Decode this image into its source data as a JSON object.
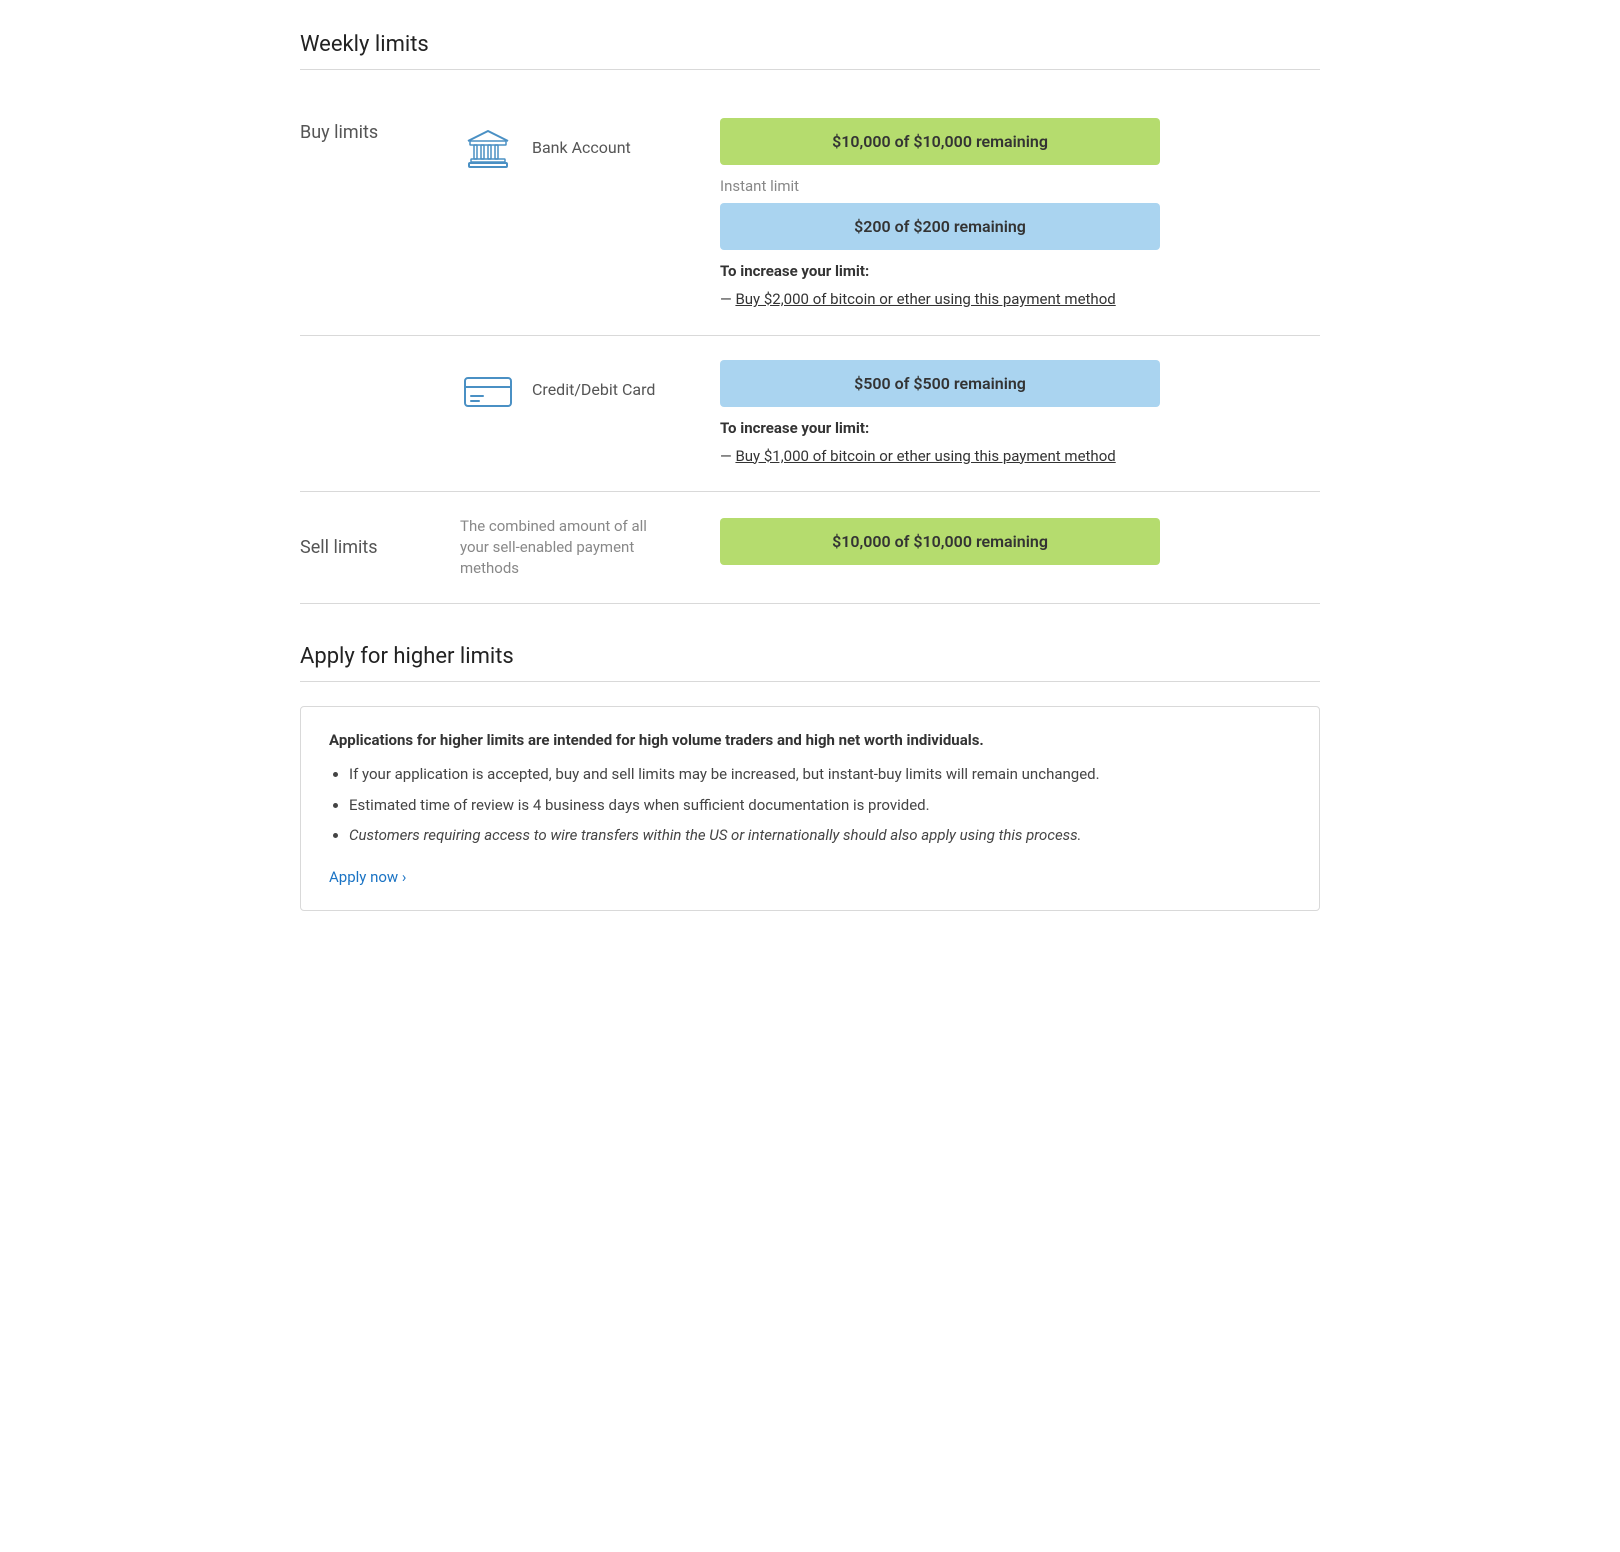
{
  "page": {
    "weekly_limits_title": "Weekly limits",
    "apply_title": "Apply for higher limits"
  },
  "buy_limits": {
    "label": "Buy limits",
    "bank_account": {
      "name": "Bank Account",
      "weekly_bar": "$10,000 of $10,000 remaining",
      "instant_label": "Instant limit",
      "instant_bar": "$200 of $200 remaining",
      "increase_title": "To increase your limit:",
      "increase_link_prefix": "— ",
      "increase_link_text": "Buy $2,000 of bitcoin or ether using this payment method"
    },
    "credit_debit": {
      "name": "Credit/Debit Card",
      "bar": "$500 of $500 remaining",
      "increase_title": "To increase your limit:",
      "increase_link_prefix": "— ",
      "increase_link_text": "Buy $1,000 of bitcoin or ether using this payment method"
    }
  },
  "sell_limits": {
    "label": "Sell limits",
    "description": "The combined amount of all your sell-enabled payment methods",
    "bar": "$10,000 of $10,000 remaining"
  },
  "apply_section": {
    "title": "Apply for higher limits",
    "info_title": "Applications for higher limits are intended for high volume traders and high net worth individuals.",
    "bullets": [
      "If your application is accepted, buy and sell limits may be increased, but instant-buy limits will remain unchanged.",
      "Estimated time of review is 4 business days when sufficient documentation is provided.",
      "Customers requiring access to wire transfers within the US or internationally should also apply using this process."
    ],
    "apply_link_text": "Apply now ›"
  }
}
